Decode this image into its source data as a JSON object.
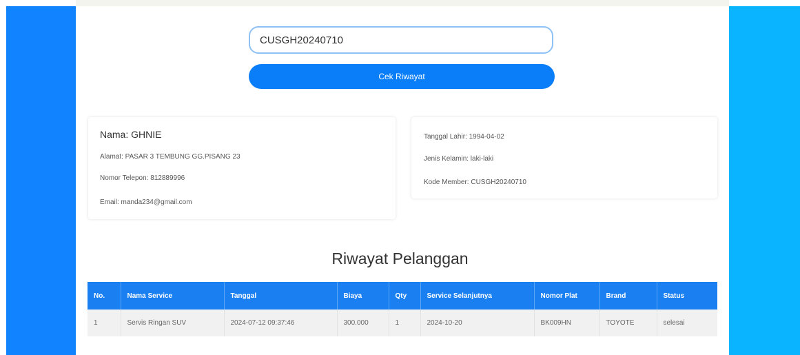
{
  "search": {
    "value": "CUSGH20240710"
  },
  "cek_button": {
    "label": "Cek Riwayat"
  },
  "customer": {
    "name": "Nama: GHNIE",
    "address": "Alamat: PASAR 3 TEMBUNG GG.PISANG 23",
    "phone": "Nomor Telepon: 812889996",
    "email": "Email: manda234@gmail.com",
    "birth_date": "Tanggal Lahir: 1994-04-02",
    "gender": "Jenis Kelamin: laki-laki",
    "member_code": "Kode Member: CUSGH20240710"
  },
  "history": {
    "title": "Riwayat Pelanggan",
    "columns": [
      "No.",
      "Nama Service",
      "Tanggal",
      "Biaya",
      "Qty",
      "Service Selanjutnya",
      "Nomor Plat",
      "Brand",
      "Status"
    ],
    "rows": [
      [
        "1",
        "Servis Ringan SUV",
        "2024-07-12 09:37:46",
        "300.000",
        "1",
        "2024-10-20",
        "BK009HN",
        "TOYOTE",
        "selesai"
      ]
    ]
  },
  "colors": {
    "left_bar": "#1283ff",
    "right_bar": "#0bb4ff",
    "accent": "#0a7ef9",
    "table_header": "#1a7ff1"
  }
}
